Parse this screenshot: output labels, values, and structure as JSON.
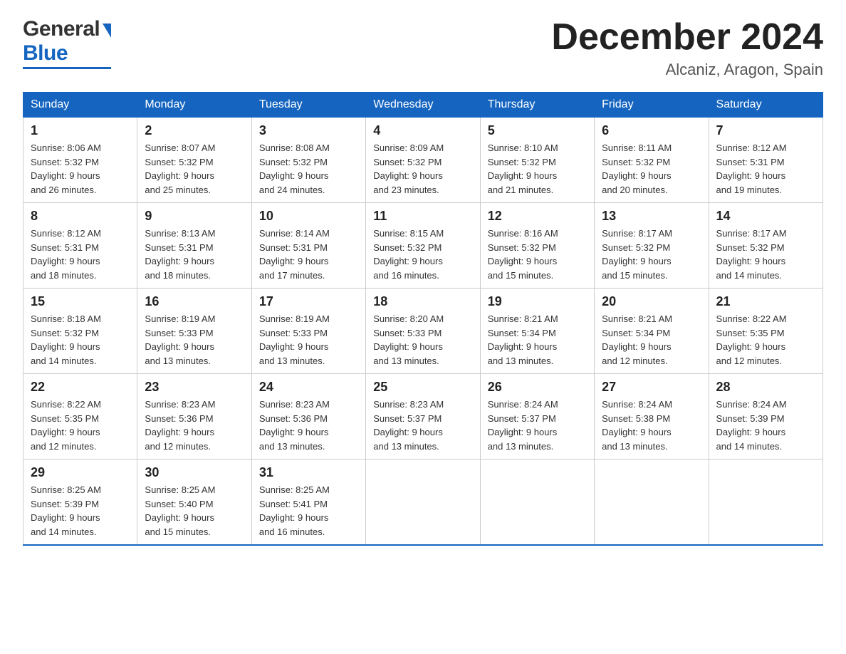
{
  "header": {
    "logo": {
      "general_text": "General",
      "blue_text": "Blue"
    },
    "title": "December 2024",
    "location": "Alcaniz, Aragon, Spain"
  },
  "weekdays": [
    "Sunday",
    "Monday",
    "Tuesday",
    "Wednesday",
    "Thursday",
    "Friday",
    "Saturday"
  ],
  "weeks": [
    [
      {
        "day": "1",
        "sunrise": "8:06 AM",
        "sunset": "5:32 PM",
        "daylight": "9 hours and 26 minutes."
      },
      {
        "day": "2",
        "sunrise": "8:07 AM",
        "sunset": "5:32 PM",
        "daylight": "9 hours and 25 minutes."
      },
      {
        "day": "3",
        "sunrise": "8:08 AM",
        "sunset": "5:32 PM",
        "daylight": "9 hours and 24 minutes."
      },
      {
        "day": "4",
        "sunrise": "8:09 AM",
        "sunset": "5:32 PM",
        "daylight": "9 hours and 23 minutes."
      },
      {
        "day": "5",
        "sunrise": "8:10 AM",
        "sunset": "5:32 PM",
        "daylight": "9 hours and 21 minutes."
      },
      {
        "day": "6",
        "sunrise": "8:11 AM",
        "sunset": "5:32 PM",
        "daylight": "9 hours and 20 minutes."
      },
      {
        "day": "7",
        "sunrise": "8:12 AM",
        "sunset": "5:31 PM",
        "daylight": "9 hours and 19 minutes."
      }
    ],
    [
      {
        "day": "8",
        "sunrise": "8:12 AM",
        "sunset": "5:31 PM",
        "daylight": "9 hours and 18 minutes."
      },
      {
        "day": "9",
        "sunrise": "8:13 AM",
        "sunset": "5:31 PM",
        "daylight": "9 hours and 18 minutes."
      },
      {
        "day": "10",
        "sunrise": "8:14 AM",
        "sunset": "5:31 PM",
        "daylight": "9 hours and 17 minutes."
      },
      {
        "day": "11",
        "sunrise": "8:15 AM",
        "sunset": "5:32 PM",
        "daylight": "9 hours and 16 minutes."
      },
      {
        "day": "12",
        "sunrise": "8:16 AM",
        "sunset": "5:32 PM",
        "daylight": "9 hours and 15 minutes."
      },
      {
        "day": "13",
        "sunrise": "8:17 AM",
        "sunset": "5:32 PM",
        "daylight": "9 hours and 15 minutes."
      },
      {
        "day": "14",
        "sunrise": "8:17 AM",
        "sunset": "5:32 PM",
        "daylight": "9 hours and 14 minutes."
      }
    ],
    [
      {
        "day": "15",
        "sunrise": "8:18 AM",
        "sunset": "5:32 PM",
        "daylight": "9 hours and 14 minutes."
      },
      {
        "day": "16",
        "sunrise": "8:19 AM",
        "sunset": "5:33 PM",
        "daylight": "9 hours and 13 minutes."
      },
      {
        "day": "17",
        "sunrise": "8:19 AM",
        "sunset": "5:33 PM",
        "daylight": "9 hours and 13 minutes."
      },
      {
        "day": "18",
        "sunrise": "8:20 AM",
        "sunset": "5:33 PM",
        "daylight": "9 hours and 13 minutes."
      },
      {
        "day": "19",
        "sunrise": "8:21 AM",
        "sunset": "5:34 PM",
        "daylight": "9 hours and 13 minutes."
      },
      {
        "day": "20",
        "sunrise": "8:21 AM",
        "sunset": "5:34 PM",
        "daylight": "9 hours and 12 minutes."
      },
      {
        "day": "21",
        "sunrise": "8:22 AM",
        "sunset": "5:35 PM",
        "daylight": "9 hours and 12 minutes."
      }
    ],
    [
      {
        "day": "22",
        "sunrise": "8:22 AM",
        "sunset": "5:35 PM",
        "daylight": "9 hours and 12 minutes."
      },
      {
        "day": "23",
        "sunrise": "8:23 AM",
        "sunset": "5:36 PM",
        "daylight": "9 hours and 12 minutes."
      },
      {
        "day": "24",
        "sunrise": "8:23 AM",
        "sunset": "5:36 PM",
        "daylight": "9 hours and 13 minutes."
      },
      {
        "day": "25",
        "sunrise": "8:23 AM",
        "sunset": "5:37 PM",
        "daylight": "9 hours and 13 minutes."
      },
      {
        "day": "26",
        "sunrise": "8:24 AM",
        "sunset": "5:37 PM",
        "daylight": "9 hours and 13 minutes."
      },
      {
        "day": "27",
        "sunrise": "8:24 AM",
        "sunset": "5:38 PM",
        "daylight": "9 hours and 13 minutes."
      },
      {
        "day": "28",
        "sunrise": "8:24 AM",
        "sunset": "5:39 PM",
        "daylight": "9 hours and 14 minutes."
      }
    ],
    [
      {
        "day": "29",
        "sunrise": "8:25 AM",
        "sunset": "5:39 PM",
        "daylight": "9 hours and 14 minutes."
      },
      {
        "day": "30",
        "sunrise": "8:25 AM",
        "sunset": "5:40 PM",
        "daylight": "9 hours and 15 minutes."
      },
      {
        "day": "31",
        "sunrise": "8:25 AM",
        "sunset": "5:41 PM",
        "daylight": "9 hours and 16 minutes."
      },
      null,
      null,
      null,
      null
    ]
  ]
}
